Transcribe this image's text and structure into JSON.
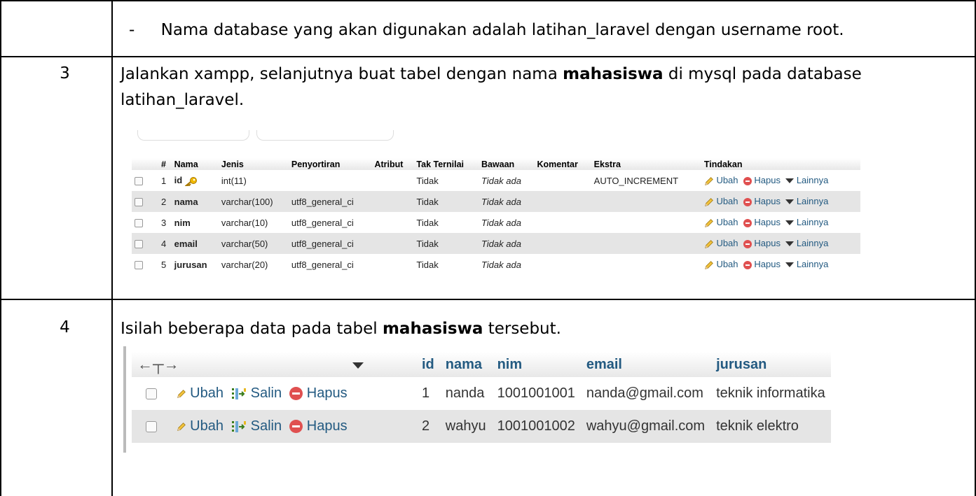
{
  "row_top": {
    "bullet": "-",
    "text": "Nama database yang akan digunakan adalah latihan_laravel dengan username root."
  },
  "row3": {
    "num": "3",
    "text_before": "Jalankan xampp, selanjutnya buat tabel dengan nama ",
    "text_bold": "mahasiswa",
    "text_after": " di mysql pada database",
    "text_line2": "latihan_laravel."
  },
  "structure": {
    "headers": [
      "#",
      "Nama",
      "Jenis",
      "Penyortiran",
      "Atribut",
      "Tak Ternilai",
      "Bawaan",
      "Komentar",
      "Ekstra",
      "Tindakan"
    ],
    "rows": [
      {
        "no": "1",
        "name": "id",
        "type": "int(11)",
        "collation": "",
        "null": "Tidak",
        "default": "Tidak ada",
        "extra": "AUTO_INCREMENT"
      },
      {
        "no": "2",
        "name": "nama",
        "type": "varchar(100)",
        "collation": "utf8_general_ci",
        "null": "Tidak",
        "default": "Tidak ada",
        "extra": ""
      },
      {
        "no": "3",
        "name": "nim",
        "type": "varchar(10)",
        "collation": "utf8_general_ci",
        "null": "Tidak",
        "default": "Tidak ada",
        "extra": ""
      },
      {
        "no": "4",
        "name": "email",
        "type": "varchar(50)",
        "collation": "utf8_general_ci",
        "null": "Tidak",
        "default": "Tidak ada",
        "extra": ""
      },
      {
        "no": "5",
        "name": "jurusan",
        "type": "varchar(20)",
        "collation": "utf8_general_ci",
        "null": "Tidak",
        "default": "Tidak ada",
        "extra": ""
      }
    ],
    "actions": {
      "edit": "Ubah",
      "delete": "Hapus",
      "more": "Lainnya"
    }
  },
  "row4": {
    "num": "4",
    "text_before": "Isilah beberapa data pada tabel ",
    "text_bold": "mahasiswa",
    "text_after": " tersebut."
  },
  "browse": {
    "headers": [
      "id",
      "nama",
      "nim",
      "email",
      "jurusan"
    ],
    "actions": {
      "edit": "Ubah",
      "copy": "Salin",
      "delete": "Hapus"
    },
    "rows": [
      {
        "id": "1",
        "nama": "nanda",
        "nim": "1001001001",
        "email": "nanda@gmail.com",
        "jurusan": "teknik informatika"
      },
      {
        "id": "2",
        "nama": "wahyu",
        "nim": "1001001002",
        "email": "wahyu@gmail.com",
        "jurusan": "teknik elektro"
      }
    ]
  },
  "colors": {
    "link": "#235a81",
    "delete": "#e05050",
    "row_alt": "#e5e5e5"
  }
}
